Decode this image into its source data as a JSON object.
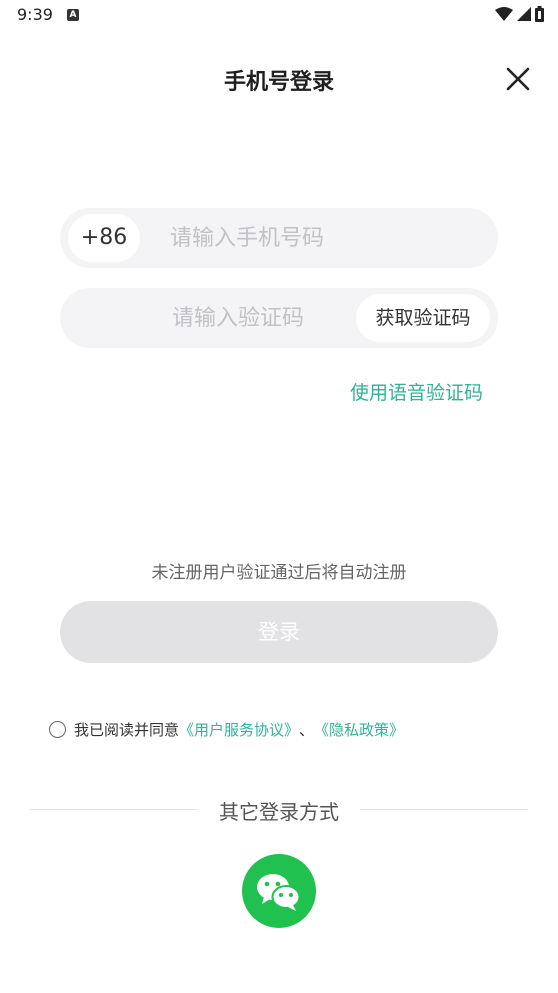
{
  "status_bar": {
    "time": "9:39",
    "app_icon_letter": "A"
  },
  "header": {
    "title": "手机号登录"
  },
  "phone_input": {
    "country_code": "+86",
    "placeholder": "请输入手机号码",
    "value": ""
  },
  "code_input": {
    "placeholder": "请输入验证码",
    "value": "",
    "get_code_label": "获取验证码"
  },
  "voice_code_link": "使用语音验证码",
  "auto_register_notice": "未注册用户验证通过后将自动注册",
  "login_button_label": "登录",
  "agreement": {
    "prefix": "我已阅读并同意",
    "user_agreement_link": "《用户服务协议》",
    "separator": "、",
    "privacy_link": "《隐私政策》",
    "checked": false
  },
  "other_login": {
    "label": "其它登录方式",
    "wechat_icon": "wechat-icon"
  },
  "colors": {
    "accent": "#2fb29a",
    "wechat": "#20c14f",
    "input_bg": "#f4f4f6",
    "login_disabled": "#e2e2e4"
  }
}
